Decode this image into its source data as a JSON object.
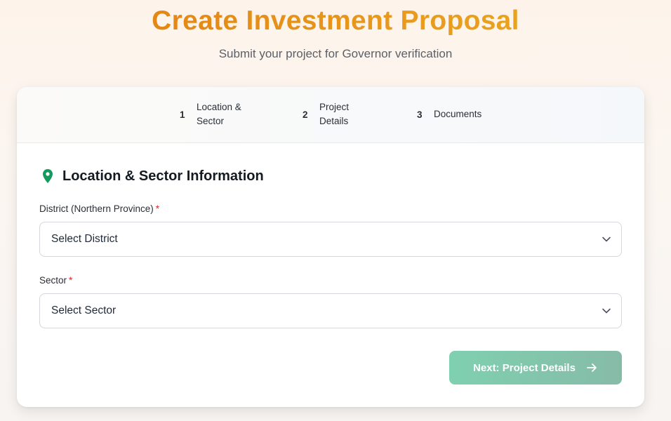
{
  "header": {
    "title": "Create Investment Proposal",
    "subtitle": "Submit your project for Governor verification"
  },
  "stepper": {
    "steps": [
      {
        "number": "1",
        "label": "Location & Sector"
      },
      {
        "number": "2",
        "label": "Project Details"
      },
      {
        "number": "3",
        "label": "Documents"
      }
    ]
  },
  "form": {
    "section_title": "Location & Sector Information",
    "section_icon": "map-pin-icon",
    "district": {
      "label": "District (Northern Province)",
      "required_mark": "*",
      "value": "Select District"
    },
    "sector": {
      "label": "Sector",
      "required_mark": "*",
      "value": "Select Sector"
    },
    "next_button_label": "Next: Project Details"
  },
  "colors": {
    "title_gradient_start": "#e07b12",
    "title_gradient_end": "#ebac22",
    "pin_icon": "#159a5e",
    "required": "#dc2626",
    "button_start": "#7fd0b0",
    "button_end": "#86bba8"
  }
}
